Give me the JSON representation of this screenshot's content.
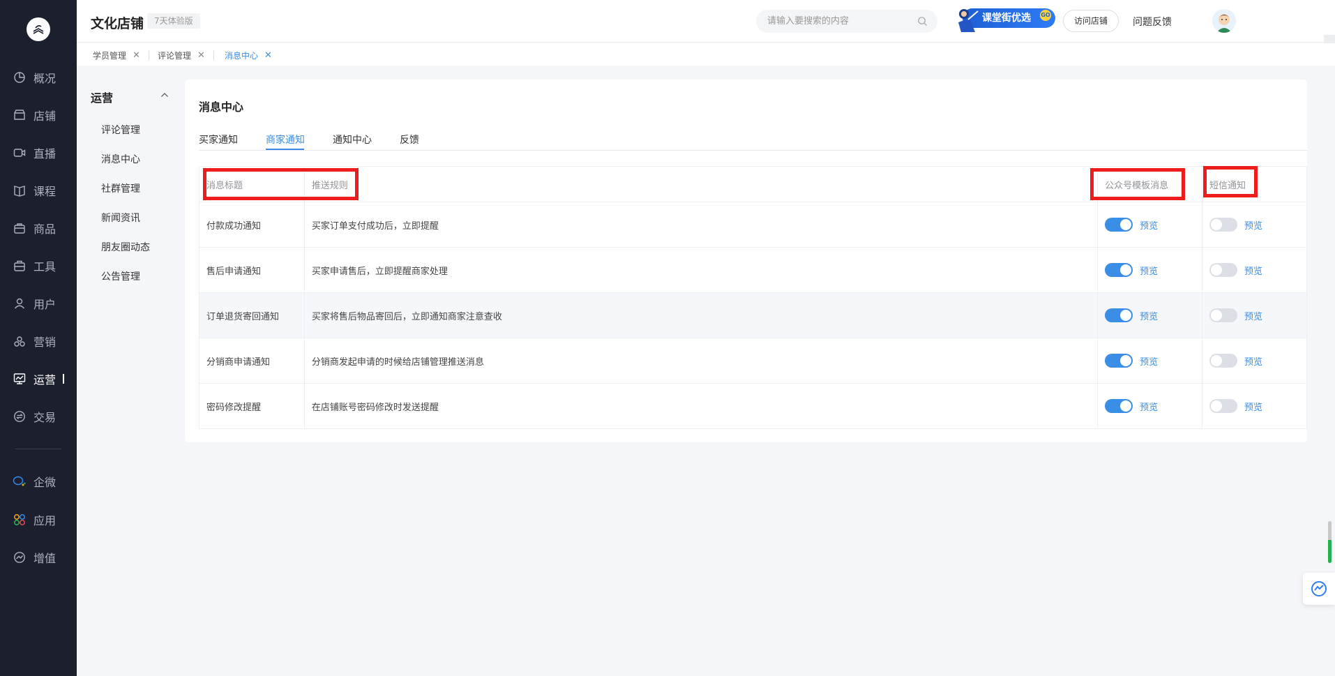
{
  "app": {
    "shop_name": "文化店铺",
    "trial_badge": "7天体验版"
  },
  "header": {
    "search_placeholder": "请输入要搜索的内容",
    "promo_label": "课堂街优选",
    "promo_go": "GO",
    "visit_shop": "访问店铺",
    "feedback": "问题反馈"
  },
  "nav": {
    "items": [
      {
        "label": "概况",
        "icon": "pie-chart-icon"
      },
      {
        "label": "店铺",
        "icon": "store-icon"
      },
      {
        "label": "直播",
        "icon": "video-icon"
      },
      {
        "label": "课程",
        "icon": "book-icon"
      },
      {
        "label": "商品",
        "icon": "shop-bag-icon"
      },
      {
        "label": "工具",
        "icon": "toolbox-icon"
      },
      {
        "label": "用户",
        "icon": "user-icon"
      },
      {
        "label": "营销",
        "icon": "marketing-icon"
      },
      {
        "label": "运营",
        "icon": "operation-icon",
        "active": true
      },
      {
        "label": "交易",
        "icon": "exchange-icon"
      },
      {
        "label": "企微",
        "icon": "wecom-icon"
      },
      {
        "label": "应用",
        "icon": "apps-icon"
      },
      {
        "label": "增值",
        "icon": "value-added-icon"
      }
    ]
  },
  "tags": [
    {
      "label": "学员管理"
    },
    {
      "label": "评论管理"
    },
    {
      "label": "消息中心",
      "active": true
    }
  ],
  "subnav": {
    "heading": "运营",
    "items": [
      "评论管理",
      "消息中心",
      "社群管理",
      "新闻资讯",
      "朋友圈动态",
      "公告管理"
    ]
  },
  "main": {
    "title": "消息中心",
    "tabs": [
      {
        "label": "买家通知"
      },
      {
        "label": "商家通知",
        "active": true
      },
      {
        "label": "通知中心"
      },
      {
        "label": "反馈"
      }
    ],
    "table": {
      "headers": {
        "title": "消息标题",
        "rule": "推送规则",
        "wechat": "公众号模板消息",
        "sms": "短信通知"
      },
      "preview_label": "预览",
      "rows": [
        {
          "title": "付款成功通知",
          "rule": "买家订单支付成功后，立即提醒",
          "wechat_on": true,
          "sms_on": false
        },
        {
          "title": "售后申请通知",
          "rule": "买家申请售后，立即提醒商家处理",
          "wechat_on": true,
          "sms_on": false
        },
        {
          "title": "订单退货寄回通知",
          "rule": "买家将售后物品寄回后，立即通知商家注意查收",
          "wechat_on": true,
          "sms_on": false
        },
        {
          "title": "分销商申请通知",
          "rule": "分销商发起申请的时候给店铺管理推送消息",
          "wechat_on": true,
          "sms_on": false
        },
        {
          "title": "密码修改提醒",
          "rule": "在店铺账号密码修改时发送提醒",
          "wechat_on": true,
          "sms_on": false
        }
      ]
    }
  },
  "colors": {
    "accent": "#3a8ee6",
    "nav_bg": "#1c1f2e",
    "highlight_box": "#ee1c1c"
  }
}
